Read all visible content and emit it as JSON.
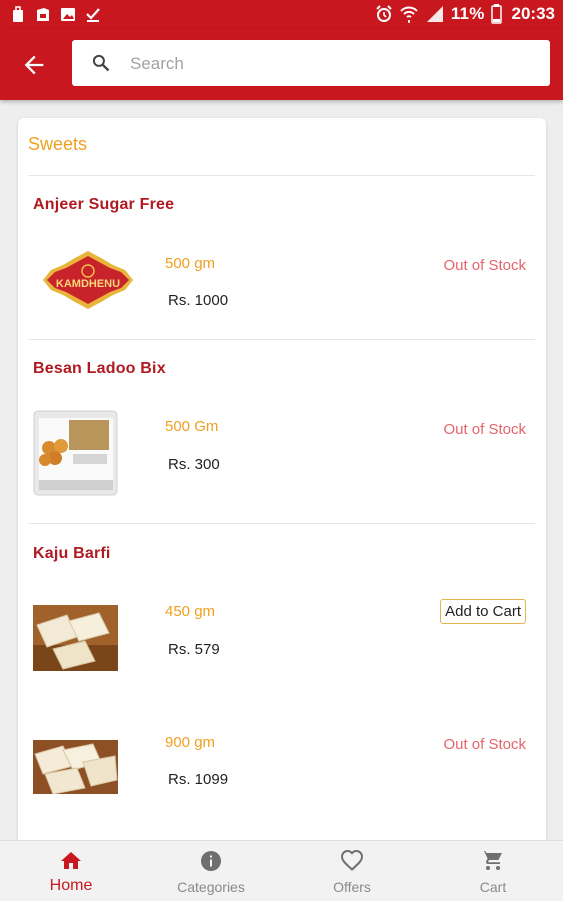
{
  "status_bar": {
    "battery": "11%",
    "time": "20:33"
  },
  "search": {
    "placeholder": "Search"
  },
  "section": {
    "title": "Sweets"
  },
  "products": [
    {
      "name": "Anjeer Sugar Free",
      "logo_text": "KAMDHENU",
      "variants": [
        {
          "weight": "500 gm",
          "price": "Rs. 1000",
          "status": "Out of Stock"
        }
      ]
    },
    {
      "name": "Besan Ladoo Bix",
      "variants": [
        {
          "weight": "500 Gm",
          "price": "Rs. 300",
          "status": "Out of Stock"
        }
      ]
    },
    {
      "name": "Kaju Barfi",
      "variants": [
        {
          "weight": "450 gm",
          "price": "Rs. 579",
          "action": "Add to Cart"
        },
        {
          "weight": "900 gm",
          "price": "Rs. 1099",
          "status": "Out of Stock"
        }
      ]
    }
  ],
  "bottom_nav": {
    "active": "Home",
    "items": [
      {
        "label": "Home",
        "icon": "home-icon"
      },
      {
        "label": "Categories",
        "icon": "info-icon"
      },
      {
        "label": "Offers",
        "icon": "heart-icon"
      },
      {
        "label": "Cart",
        "icon": "cart-icon"
      }
    ]
  },
  "colors": {
    "primary_red": "#c8171e",
    "accent_orange": "#f0a020",
    "stock_red": "#e5646b"
  }
}
